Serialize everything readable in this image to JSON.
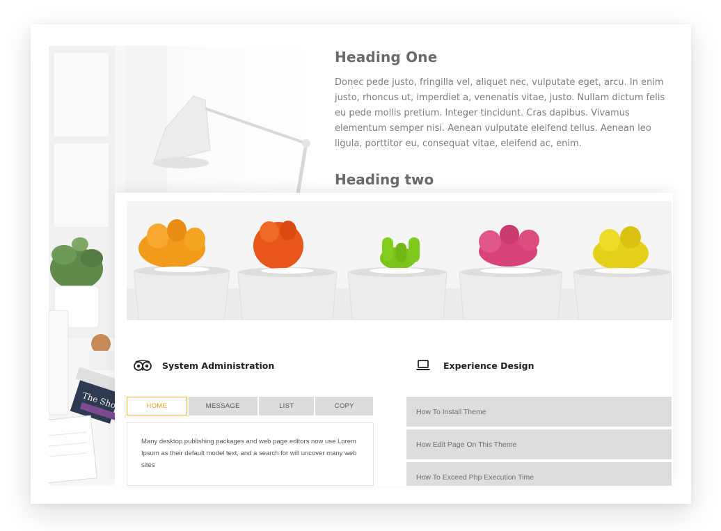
{
  "content": {
    "heading_one": "Heading One",
    "paragraph": "Donec pede justo, fringilla vel, aliquet nec, vulputate eget, arcu. In enim justo, rhoncus ut, imperdiet a, venenatis vitae, justo. Nullam dictum felis eu pede mollis pretium. Integer tincidunt. Cras dapibus. Vivamus elementum semper nisi. Aenean vulputate eleifend tellus. Aenean leo ligula, porttitor eu, consequat vitae, eleifend ac, enim.",
    "heading_two": "Heading two"
  },
  "desk_photo": {
    "book_spine_text": "The Short Sto"
  },
  "features": {
    "sysadmin": {
      "title": "System Administration",
      "icon": "tripadvisor-owl-icon"
    },
    "design": {
      "title": "Experience Design",
      "icon": "laptop-icon"
    }
  },
  "tabs": {
    "items": [
      {
        "label": "HOME",
        "active": true
      },
      {
        "label": "MESSAGE",
        "active": false
      },
      {
        "label": "LIST",
        "active": false
      },
      {
        "label": "COPY",
        "active": false
      }
    ],
    "panel_text": "Many desktop publishing packages and web page editors now use Lorem Ipsum as their default model text, and a search for will uncover many web sites"
  },
  "accordion": {
    "items": [
      "How To Install Theme",
      "How Edit Page On This Theme",
      "How To Exceed Php Execution Time"
    ]
  },
  "colors": {
    "accent": "#f0a020",
    "heading": "#6a6a6a",
    "body_text": "#7d7d7d",
    "tab_bg": "#dcdcdc",
    "accordion_bg": "#dddddd",
    "cactus_colors": [
      "#f29a1c",
      "#e8561a",
      "#7cc41c",
      "#d8437a",
      "#e5d01a"
    ]
  }
}
